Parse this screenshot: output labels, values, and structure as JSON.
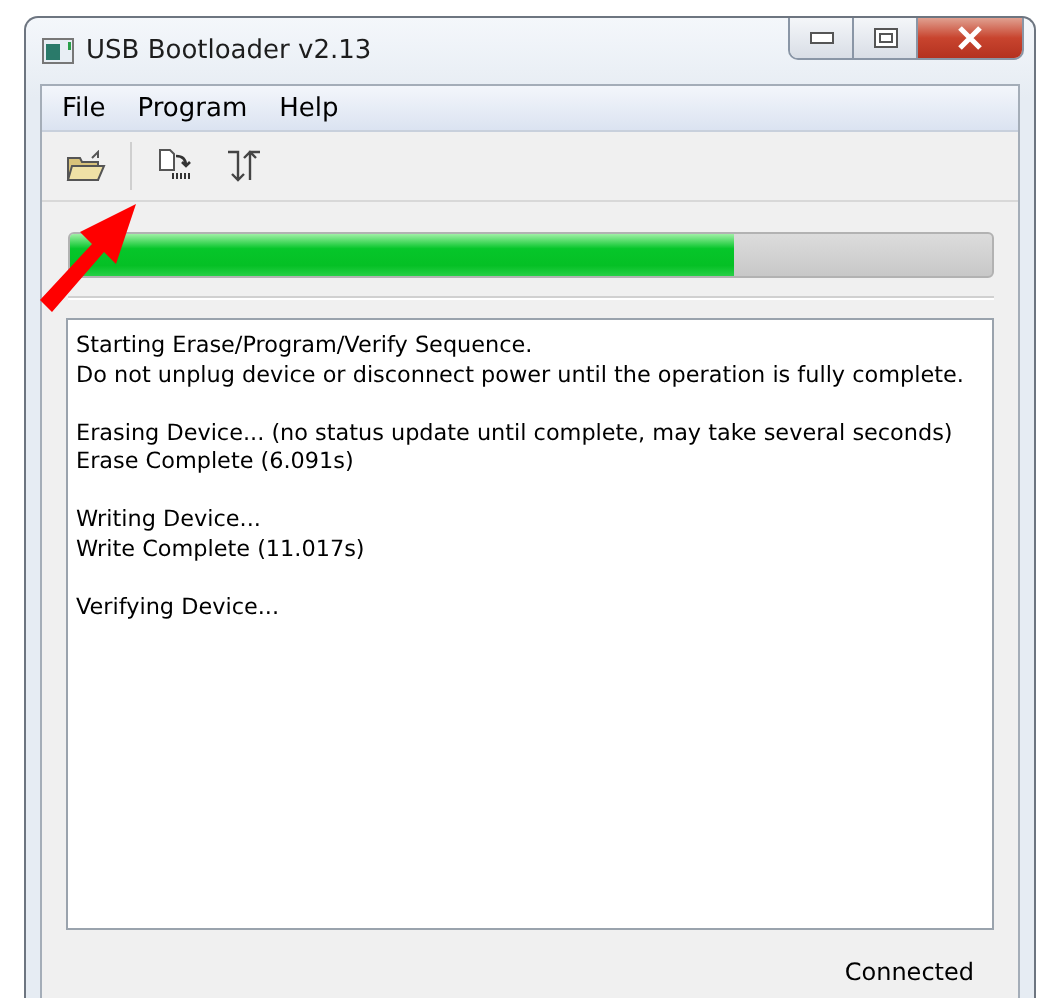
{
  "window": {
    "title": "USB Bootloader v2.13"
  },
  "menu": [
    "File",
    "Program",
    "Help"
  ],
  "toolbar": [
    {
      "kind": "open"
    },
    {
      "kind": "program"
    },
    {
      "kind": "reset"
    }
  ],
  "progress": {
    "level": 0.72
  },
  "log": [
    [
      "Starting Erase/Program/Verify Sequence.",
      "Do not unplug device or disconnect power until the operation is fully complete."
    ],
    [
      "Erasing Device... (no status update until complete, may take several seconds)",
      "Erase Complete (6.091s)"
    ],
    [
      "Writing Device...",
      "Write Complete (11.017s)"
    ],
    [
      "Verifying Device..."
    ]
  ],
  "status_bar": "Connected",
  "annotation": {
    "kind": "arrow"
  }
}
